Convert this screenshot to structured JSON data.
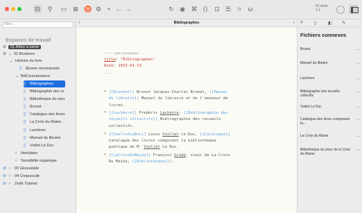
{
  "window": {
    "word_count": "52 mots",
    "ratio": "1:1"
  },
  "left_sidebar": {
    "filter_placeholder": "Filtre...",
    "section_title": "Espaces de travail",
    "items": [
      {
        "label": "01 Arbre a came"
      },
      {
        "label": "02 Boutures"
      },
      {
        "label": "Histoire du livre"
      },
      {
        "label": "Œuvre recomposée"
      },
      {
        "label": "BdConnaissance"
      },
      {
        "label": "Bibliographes"
      },
      {
        "label": "Bibliographie des re"
      },
      {
        "label": "Bibliotheque du sieu"
      },
      {
        "label": "Brunet"
      },
      {
        "label": "Catalogue des livres"
      },
      {
        "label": "La Croix du Maine"
      },
      {
        "label": "Lachèvre"
      },
      {
        "label": "Manuel du libraire"
      },
      {
        "label": "Viollet Le Duc"
      },
      {
        "label": "Hortulaire"
      },
      {
        "label": "Sensibilité organique"
      },
      {
        "label": "03 Glossolalie"
      },
      {
        "label": "04 Crepuscule"
      },
      {
        "label": "Zettlr Tutorial"
      }
    ]
  },
  "editor": {
    "doc_title": "Bibliographes",
    "frontmatter": {
      "open": "---",
      "badge": "YAML Frontmatter",
      "title_key": "title",
      "title_value": "\"Bibliographes\"",
      "date_key": "Date",
      "date_value": "2023-01-13",
      "close": "..."
    },
    "entries": [
      {
        "l1a": "[[Brunnet]]",
        "l1b": " Brunet Jacques-Charles Brunet, ",
        "l1c": "[[Manuel",
        "l2a": "du libraire]]",
        "l2b": " Manuel du libraire et de l'amateur de",
        "l3": "livres."
      },
      {
        "l1a": "[[Lachèvre]]",
        "l1b": " Frédéric ",
        "l1u": "Lachèvre",
        "l1c": ", ",
        "l1d": "[[Bibliographie des",
        "l2a": "recueils collectifs]]",
        "l2b": " Bibliographie des recueils",
        "l3": "collectifs."
      },
      {
        "l1a": "[[VielletLeDuc]]",
        "l1b": " Louis ",
        "l1u": "Viollet",
        "l1c": "-le-Duc, ",
        "l1d": "[[Catalogue]]",
        "l2": "Catalogue des livres composant la bibliothèque",
        "l3a": "poétique de M. ",
        "l3u": "Viollet",
        "l3b": " Le Duc."
      },
      {
        "l1a": "[[LaCroixDuMaine]]",
        "l1b": " François ",
        "l1u": "Grudé",
        "l1c": ", sieur de La Croix",
        "l2a": "Du Maine, ",
        "l2b": "[[Bibliotheque]]",
        "l2c": ")."
      }
    ]
  },
  "right_panel": {
    "title": "Fichiers connexes",
    "items": [
      {
        "label": "Brunet"
      },
      {
        "label": "Manuel du libraire"
      },
      {
        "label": "Lachèvre"
      },
      {
        "label": "Bibliographie des recueils collectifs"
      },
      {
        "label": "Viollet Le Duc"
      },
      {
        "label": "Catalogue des livres composant la..."
      },
      {
        "label": "La Croix du Maine"
      },
      {
        "label": "Bibliotheque du sieur de la Croix du Maine"
      }
    ]
  }
}
